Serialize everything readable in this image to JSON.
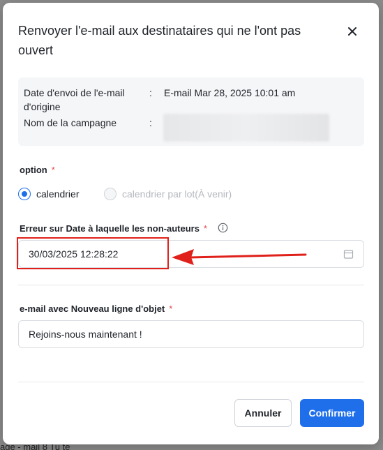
{
  "dialog": {
    "title": "Renvoyer l'e-mail aux destinataires qui ne l'ont pas ouvert",
    "close_icon": "close-icon"
  },
  "info": {
    "rows": [
      {
        "label": "Date d'envoi de l'e-mail d'origine",
        "colon": ":",
        "value": "E-mail Mar 28, 2025 10:01 am"
      },
      {
        "label": "Nom de la campagne",
        "colon": ":",
        "value": ""
      }
    ]
  },
  "option": {
    "label": "option",
    "required_mark": "*",
    "choices": [
      {
        "label": "calendrier",
        "checked": true,
        "disabled": false
      },
      {
        "label": "calendrier par lot(À venir)",
        "checked": false,
        "disabled": true
      }
    ]
  },
  "date_field": {
    "label": "Erreur sur Date à laquelle les non-auteurs",
    "required_mark": "*",
    "value": "30/03/2025 12:28:22",
    "icon": "calendar-icon"
  },
  "subject_field": {
    "label": "e-mail avec Nouveau ligne d'objet",
    "required_mark": "*",
    "value": "Rejoins-nous maintenant !"
  },
  "footer": {
    "cancel_label": "Annuler",
    "confirm_label": "Confirmer"
  },
  "background": {
    "bottom_text": "age - mail 8 Tu te"
  },
  "colors": {
    "primary": "#1f6feb",
    "required": "#e5484d",
    "annotation": "#e0201a"
  }
}
